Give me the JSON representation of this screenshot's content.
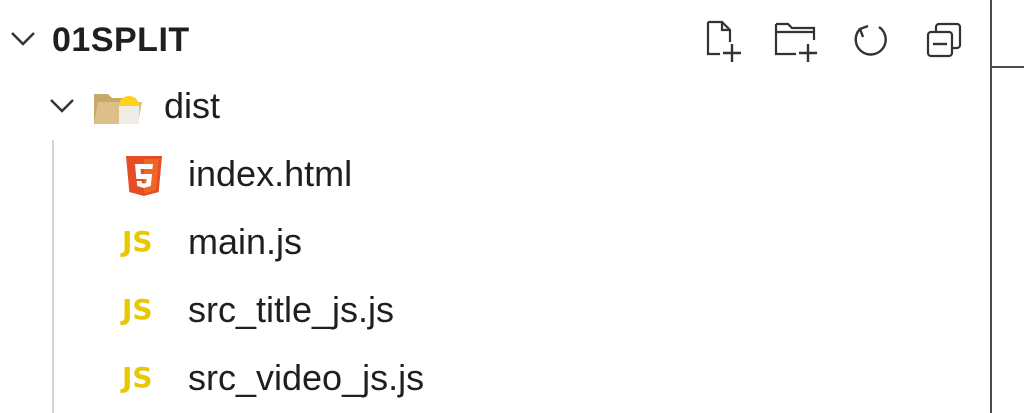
{
  "explorer": {
    "title": "01SPLIT",
    "actions": [
      {
        "name": "new-file",
        "icon": "new-file-icon"
      },
      {
        "name": "new-folder",
        "icon": "new-folder-icon"
      },
      {
        "name": "refresh",
        "icon": "refresh-icon"
      },
      {
        "name": "collapse-all",
        "icon": "collapse-all-icon"
      }
    ],
    "folder": {
      "label": "dist",
      "icon": "folder-open-icon",
      "expanded": true
    },
    "files": [
      {
        "label": "index.html",
        "icon": "html5-icon",
        "icon_text": "5",
        "icon_color": "#e44d26"
      },
      {
        "label": "main.js",
        "icon": "js-icon",
        "icon_text": "JS",
        "icon_color": "#e8c800"
      },
      {
        "label": "src_title_js.js",
        "icon": "js-icon",
        "icon_text": "JS",
        "icon_color": "#e8c800"
      },
      {
        "label": "src_video_js.js",
        "icon": "js-icon",
        "icon_text": "JS",
        "icon_color": "#e8c800"
      }
    ]
  }
}
